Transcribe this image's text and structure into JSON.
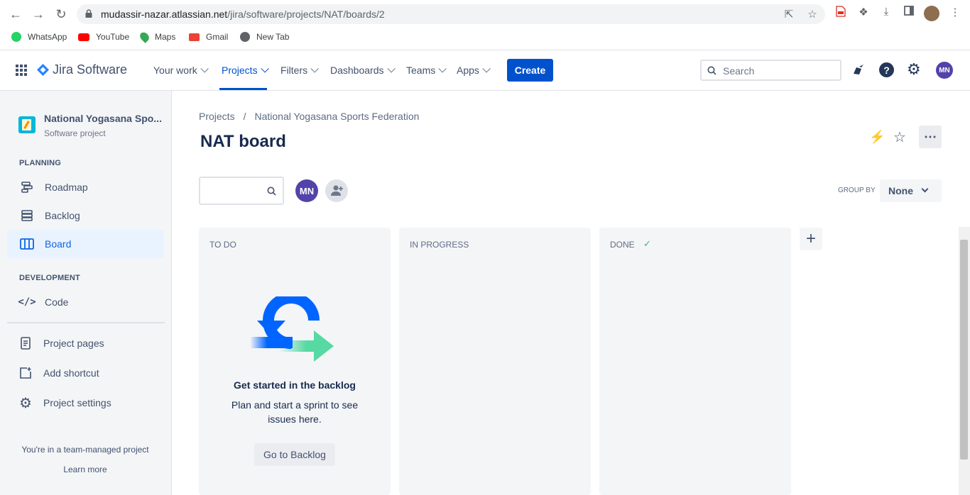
{
  "browser": {
    "url_host": "mudassir-nazar.atlassian.net",
    "url_path": "/jira/software/projects/NAT/boards/2",
    "bookmarks": [
      {
        "label": "WhatsApp",
        "icon": "whatsapp-icon",
        "color": "#25d366"
      },
      {
        "label": "YouTube",
        "icon": "youtube-icon",
        "color": "#ff0000"
      },
      {
        "label": "Maps",
        "icon": "maps-icon",
        "color": "#34a853"
      },
      {
        "label": "Gmail",
        "icon": "gmail-icon",
        "color": "#ea4335"
      },
      {
        "label": "New Tab",
        "icon": "globe-icon",
        "color": "#5f6368"
      }
    ]
  },
  "topnav": {
    "product": "Jira Software",
    "items": [
      "Your work",
      "Projects",
      "Filters",
      "Dashboards",
      "Teams",
      "Apps"
    ],
    "active": "Projects",
    "create": "Create",
    "search_placeholder": "Search",
    "user_initials": "MN"
  },
  "sidebar": {
    "project_name": "National Yogasana Spo...",
    "project_type": "Software project",
    "planning_heading": "PLANNING",
    "planning_items": [
      "Roadmap",
      "Backlog",
      "Board"
    ],
    "development_heading": "DEVELOPMENT",
    "development_items": [
      "Code"
    ],
    "other_items": [
      "Project pages",
      "Add shortcut",
      "Project settings"
    ],
    "footer_text": "You're in a team-managed project",
    "footer_link": "Learn more"
  },
  "main": {
    "breadcrumb_root": "Projects",
    "breadcrumb_sep": "/",
    "breadcrumb_project": "National Yogasana Sports Federation",
    "title": "NAT board",
    "avatar_initials": "MN",
    "group_by_label": "GROUP BY",
    "group_by_value": "None",
    "columns": [
      "TO DO",
      "IN PROGRESS",
      "DONE"
    ],
    "empty_title": "Get started in the backlog",
    "empty_line1": "Plan and start a sprint to see",
    "empty_line2": "issues here.",
    "empty_button": "Go to Backlog"
  },
  "colors": {
    "brand": "#0052cc",
    "avatar": "#5243aa",
    "done_check": "#36b37e"
  }
}
